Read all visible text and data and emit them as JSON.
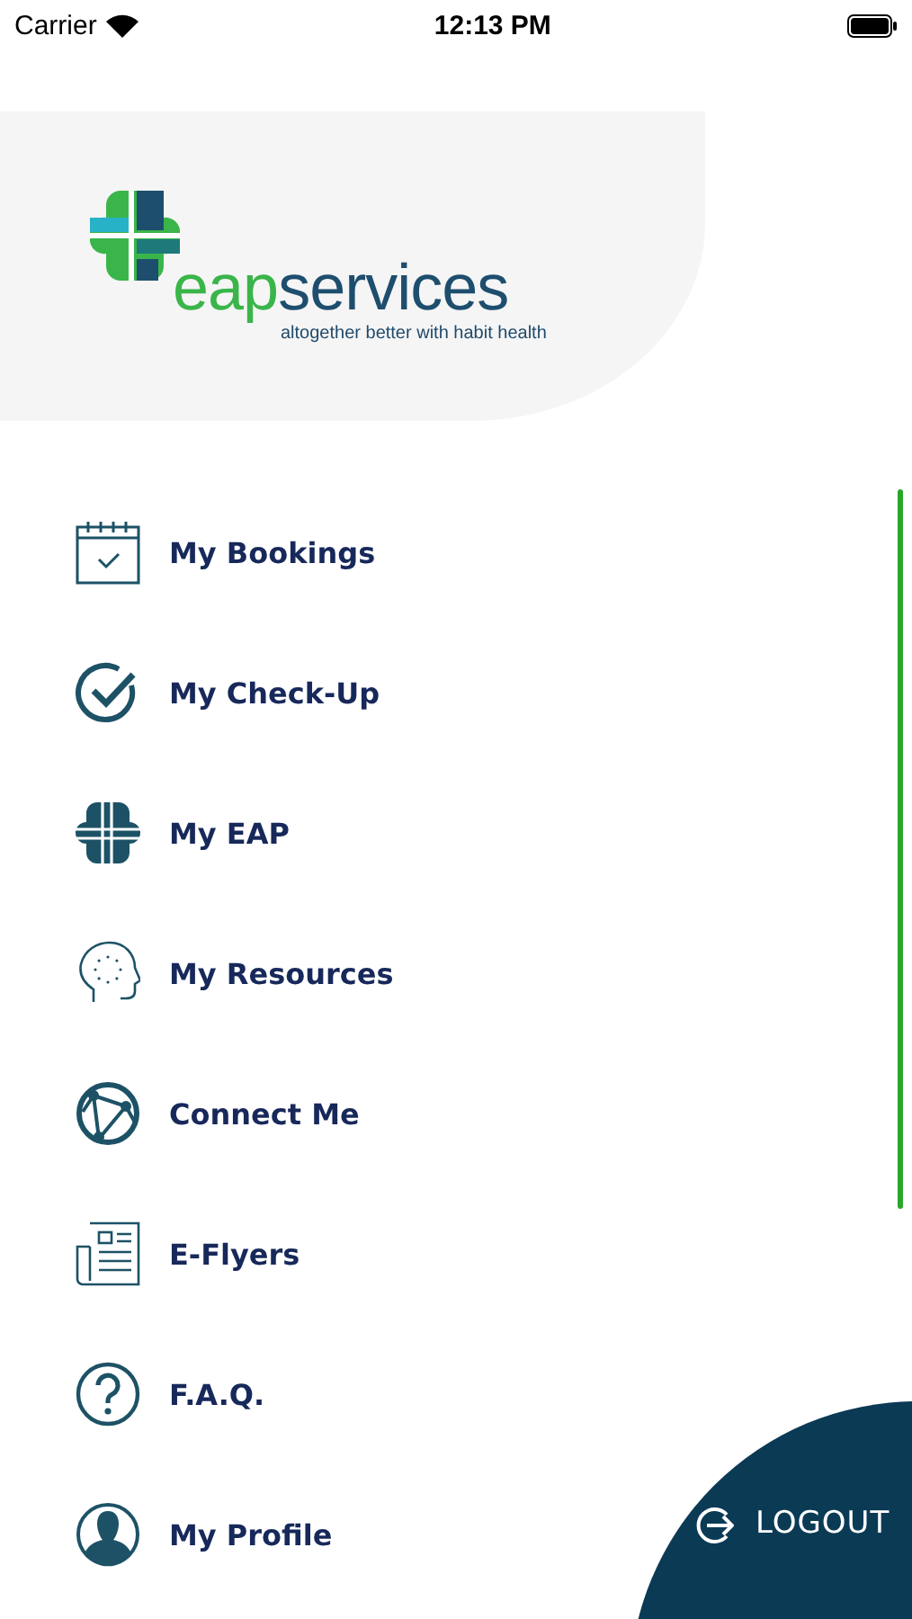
{
  "status_bar": {
    "carrier": "Carrier",
    "time": "12:13 PM"
  },
  "logo": {
    "part_1": "eap",
    "part_2": "services",
    "tagline": "altogether better with habit health"
  },
  "menu": [
    {
      "kind": "calendar",
      "label": "My Bookings"
    },
    {
      "kind": "check",
      "label": "My Check-Up"
    },
    {
      "kind": "cross",
      "label": "My EAP"
    },
    {
      "kind": "head",
      "label": "My Resources"
    },
    {
      "kind": "globe",
      "label": "Connect Me"
    },
    {
      "kind": "flyer",
      "label": "E-Flyers"
    },
    {
      "kind": "question",
      "label": "F.A.Q."
    },
    {
      "kind": "person",
      "label": "My Profile"
    }
  ],
  "logout": {
    "label": "LOGOUT"
  }
}
